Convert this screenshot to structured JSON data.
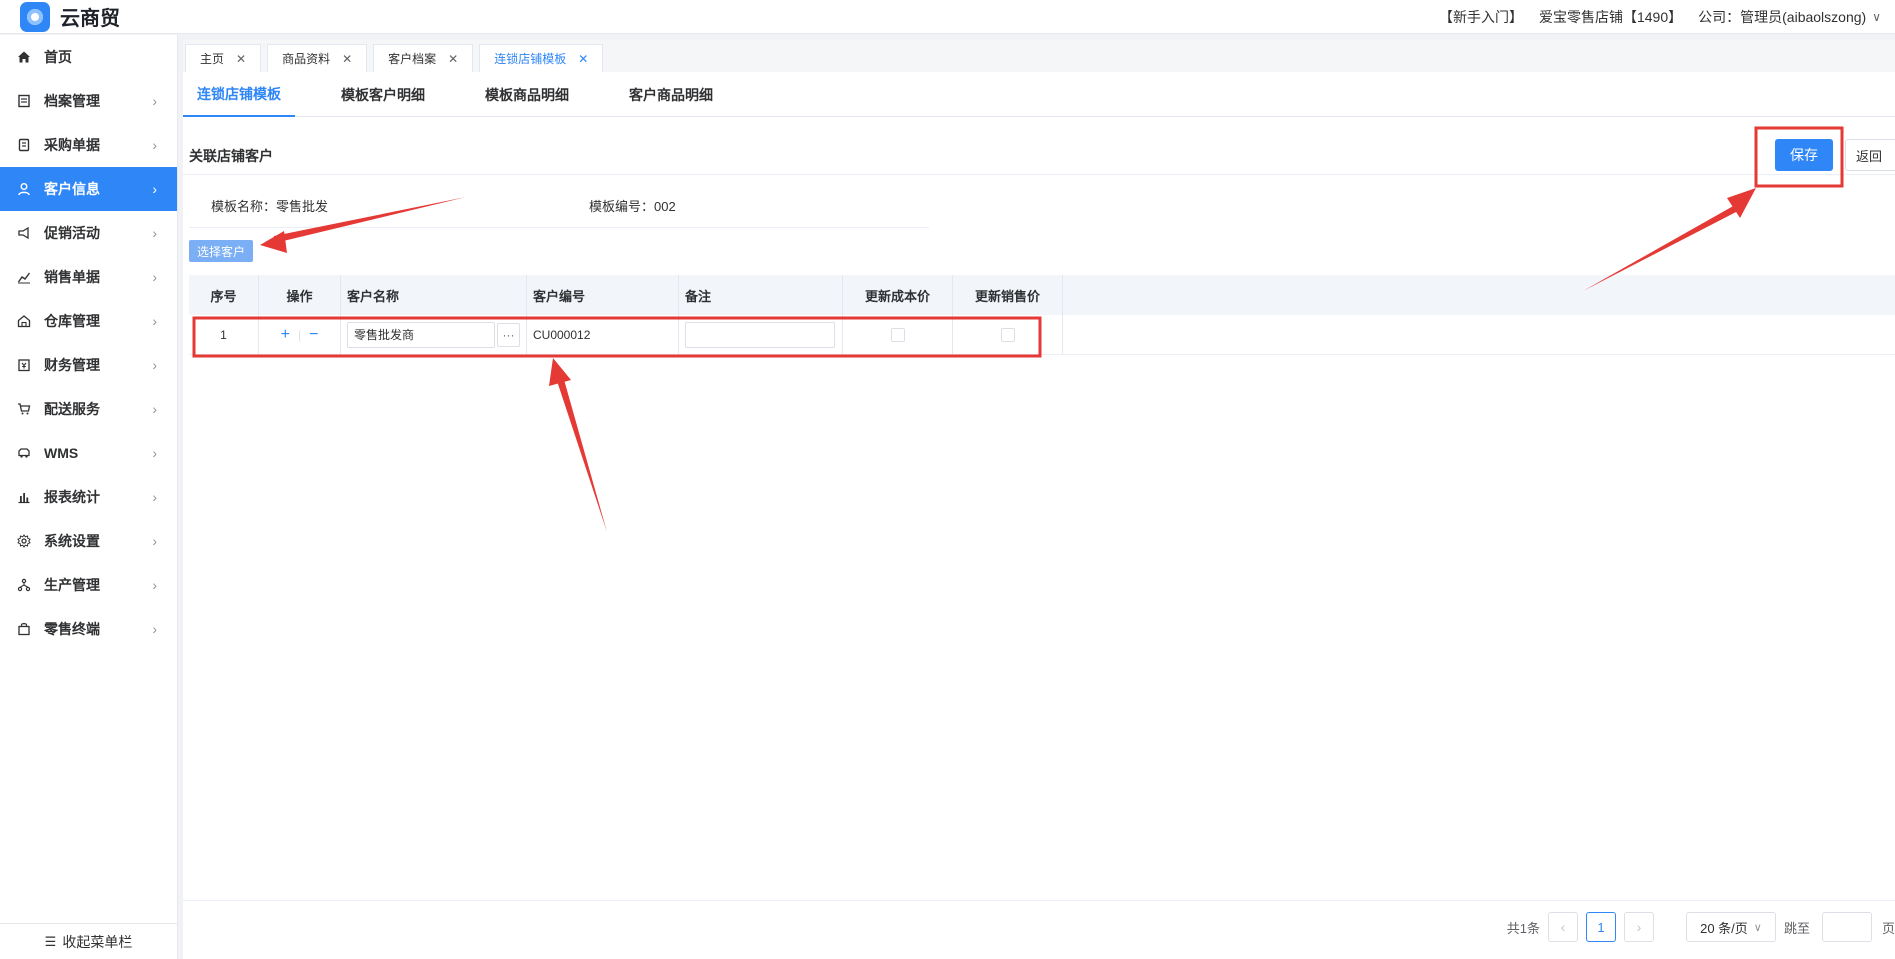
{
  "app": {
    "name": "云商贸"
  },
  "header": {
    "guide": "【新手入门】",
    "store": "爱宝零售店铺【1490】",
    "account": "公司：管理员(aibaolszong)",
    "dropdown_icon": "chevron-down-icon"
  },
  "sidebar": {
    "items": [
      {
        "label": "首页",
        "icon": "home-icon",
        "has_arrow": false,
        "active": false
      },
      {
        "label": "档案管理",
        "icon": "archive-icon",
        "has_arrow": true,
        "active": false
      },
      {
        "label": "采购单据",
        "icon": "purchase-icon",
        "has_arrow": true,
        "active": false
      },
      {
        "label": "客户信息",
        "icon": "user-icon",
        "has_arrow": true,
        "active": true
      },
      {
        "label": "促销活动",
        "icon": "megaphone-icon",
        "has_arrow": true,
        "active": false
      },
      {
        "label": "销售单据",
        "icon": "chart-line-icon",
        "has_arrow": true,
        "active": false
      },
      {
        "label": "仓库管理",
        "icon": "warehouse-icon",
        "has_arrow": true,
        "active": false
      },
      {
        "label": "财务管理",
        "icon": "finance-icon",
        "has_arrow": true,
        "active": false
      },
      {
        "label": "配送服务",
        "icon": "cart-icon",
        "has_arrow": true,
        "active": false
      },
      {
        "label": "WMS",
        "icon": "truck-icon",
        "has_arrow": true,
        "active": false
      },
      {
        "label": "报表统计",
        "icon": "bar-chart-icon",
        "has_arrow": true,
        "active": false
      },
      {
        "label": "系统设置",
        "icon": "gear-icon",
        "has_arrow": true,
        "active": false
      },
      {
        "label": "生产管理",
        "icon": "network-icon",
        "has_arrow": true,
        "active": false
      },
      {
        "label": "零售终端",
        "icon": "bag-icon",
        "has_arrow": true,
        "active": false
      }
    ],
    "collapse_label": "收起菜单栏"
  },
  "page_tabs": [
    {
      "label": "主页",
      "active": false
    },
    {
      "label": "商品资料",
      "active": false
    },
    {
      "label": "客户档案",
      "active": false
    },
    {
      "label": "连锁店铺模板",
      "active": true
    }
  ],
  "sub_tabs": [
    {
      "label": "连锁店铺模板",
      "active": true
    },
    {
      "label": "模板客户明细",
      "active": false
    },
    {
      "label": "模板商品明细",
      "active": false
    },
    {
      "label": "客户商品明细",
      "active": false
    }
  ],
  "section": {
    "title": "关联店铺客户",
    "save_label": "保存",
    "back_label": "返回"
  },
  "info": {
    "template_name": "模板名称：零售批发",
    "template_code": "模板编号：002"
  },
  "select_customer_label": "选择客户",
  "table": {
    "columns": [
      "序号",
      "操作",
      "客户名称",
      "客户编号",
      "备注",
      "更新成本价",
      "更新销售价"
    ],
    "rows": [
      {
        "index": "1",
        "customer_name": "零售批发商",
        "customer_code": "CU000012",
        "note": "",
        "update_cost": false,
        "update_price": false
      }
    ]
  },
  "pagination": {
    "total": "共1条",
    "current_page": "1",
    "page_size": "20 条/页",
    "jump_label": "跳至",
    "page_unit": "页"
  },
  "colors": {
    "accent": "#2f86f6",
    "annotation": "#e53935"
  }
}
